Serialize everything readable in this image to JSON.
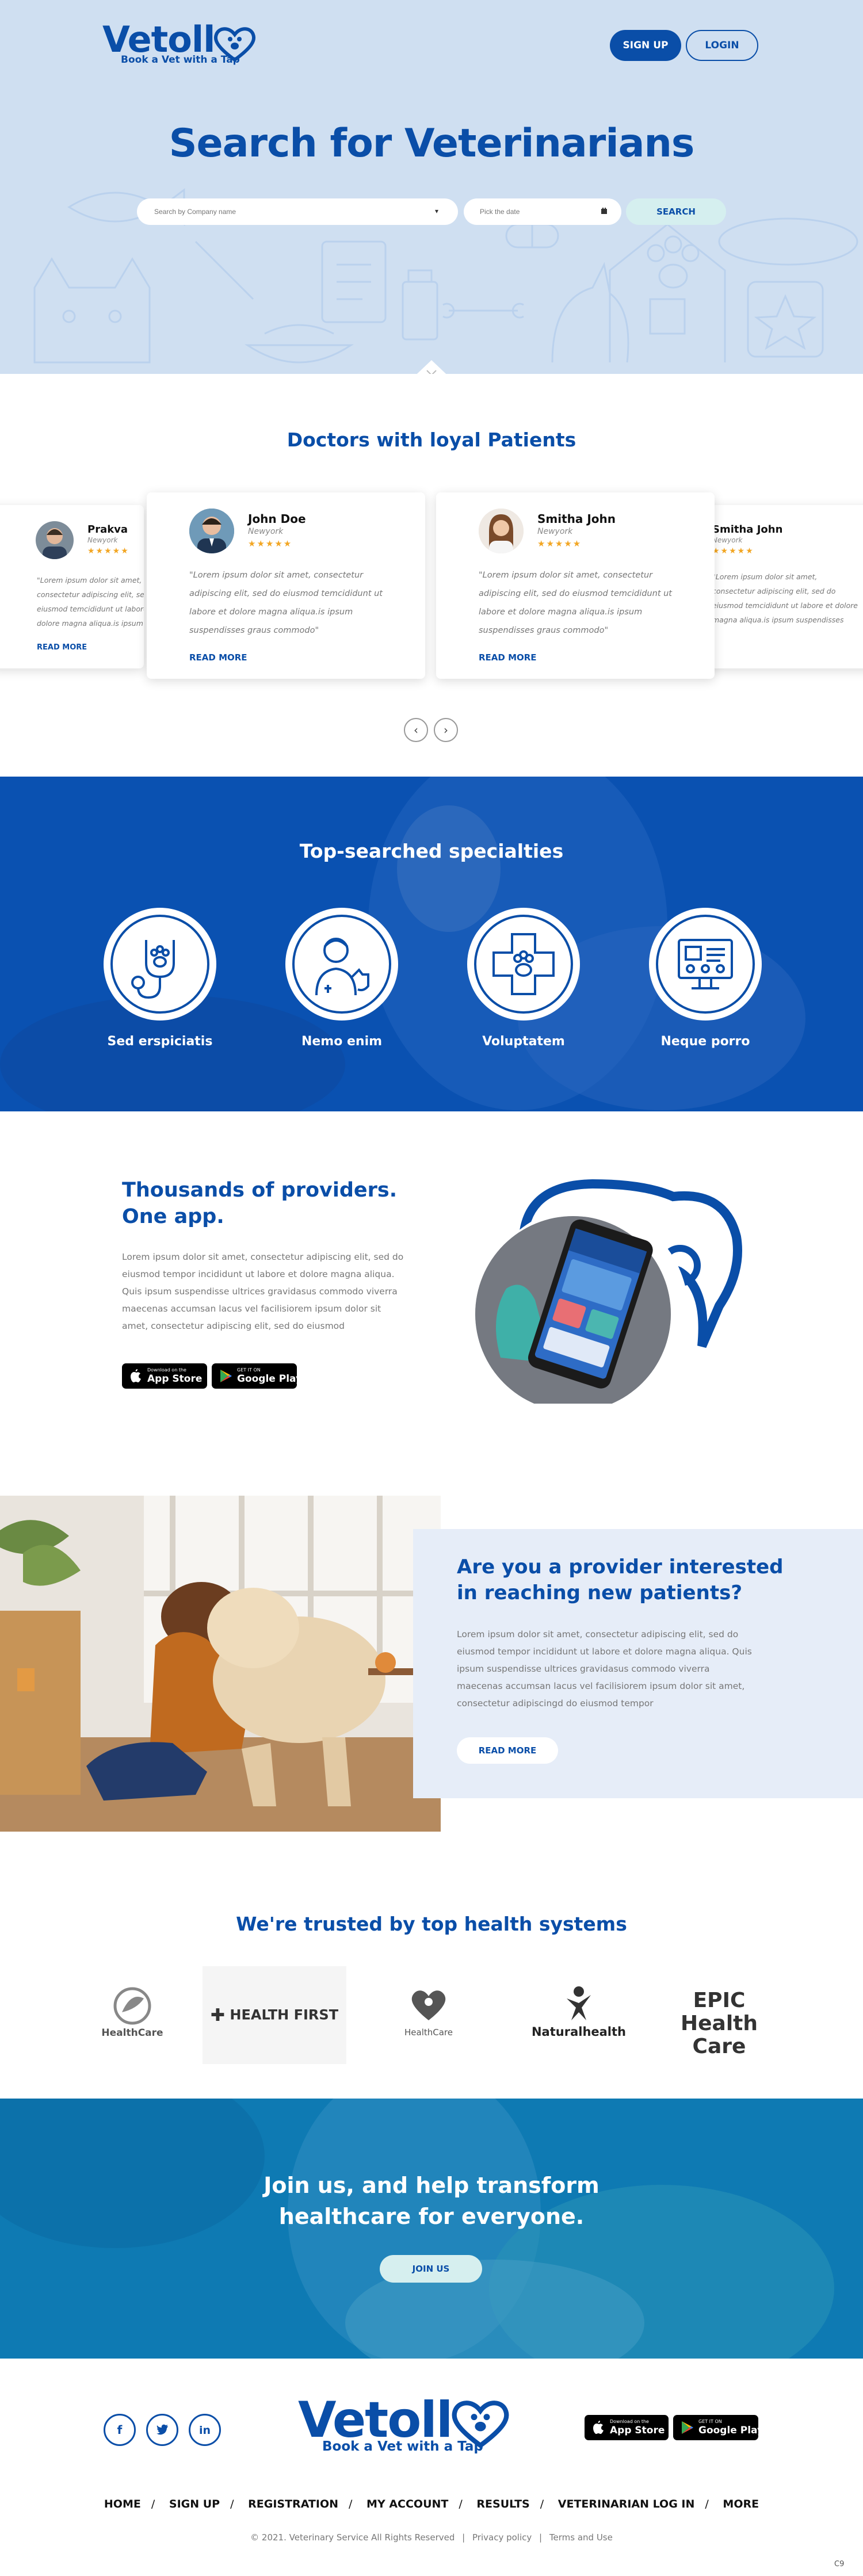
{
  "header": {
    "logo_text": "Vetoll",
    "logo_tagline": "Book a Vet with a Tap",
    "signup_label": "SIGN UP",
    "login_label": "LOGIN"
  },
  "hero": {
    "title": "Search for Veterinarians",
    "company_placeholder": "Search by Company name",
    "date_placeholder": "Pick the date",
    "search_label": "SEARCH"
  },
  "doctors": {
    "title": "Doctors with loyal Patients",
    "stars": "★★★★★",
    "read_more": "READ MORE",
    "cards": [
      {
        "name": "Prakva",
        "city": "Newyork",
        "quote": "\"Lorem ipsum dolor sit amet, consectetur adipiscing elit, sed do eiusmod temcididunt ut labore et dolore magna aliqua.is ipsum suspendisses graus commodo\""
      },
      {
        "name": "John Doe",
        "city": "Newyork",
        "quote": "\"Lorem ipsum dolor sit amet, consectetur adipiscing elit, sed do eiusmod temcididunt ut labore et dolore magna aliqua.is ipsum suspendisses graus commodo\""
      },
      {
        "name": "Smitha John",
        "city": "Newyork",
        "quote": "\"Lorem ipsum dolor sit amet, consectetur adipiscing elit, sed do eiusmod temcididunt ut labore et dolore magna aliqua.is ipsum suspendisses graus commodo\""
      },
      {
        "name": "Smitha John",
        "city": "Newyork",
        "quote": "\"Lorem ipsum dolor sit amet, consectetur adipiscing elit, sed do eiusmod temcididunt ut labore et dolore magna aliqua.is ipsum suspendisses graus commodo\""
      }
    ]
  },
  "specialties": {
    "title": "Top-searched specialties",
    "items": [
      {
        "label": "Sed erspiciatis",
        "icon": "stethoscope-paw-icon"
      },
      {
        "label": "Nemo enim",
        "icon": "vet-doctor-dog-icon"
      },
      {
        "label": "Voluptatem",
        "icon": "medical-cross-paw-icon"
      },
      {
        "label": "Neque porro",
        "icon": "pet-clinic-screen-icon"
      }
    ]
  },
  "providers": {
    "title_line1": "Thousands of providers.",
    "title_line2": "One app.",
    "text": "Lorem ipsum dolor sit amet, consectetur adipiscing elit, sed do eiusmod tempor incididunt ut labore et dolore magna aliqua. Quis ipsum suspendisse ultrices gravidasus commodo viverra maecenas accumsan lacus vel facilisiorem ipsum dolor sit amet, consectetur adipiscing elit, sed do eiusmod",
    "appstore_small": "Download on the",
    "appstore_big": "App Store",
    "googleplay_small": "GET IT ON",
    "googleplay_big": "Google Play"
  },
  "interest": {
    "title_line1": "Are you a provider interested",
    "title_line2": "in reaching new patients?",
    "text": "Lorem ipsum dolor sit amet, consectetur adipiscing elit, sed do eiusmod tempor incididunt ut labore et dolore magna aliqua. Quis ipsum suspendisse ultrices gravidasus commodo viverra maecenas accumsan lacus vel facilisiorem ipsum dolor sit amet, consectetur adipiscingd do eiusmod tempor",
    "read_more": "READ MORE"
  },
  "trusted": {
    "title": "We're trusted by top health systems",
    "logos": [
      "HealthCare",
      "HEALTH FIRST",
      "HealthCare",
      "Naturalhealth",
      "EPIC Health Care"
    ]
  },
  "join": {
    "title_line1": "Join us, and help transform",
    "title_line2": "healthcare for everyone.",
    "button": "JOIN US"
  },
  "footer": {
    "nav": [
      "HOME",
      "SIGN UP",
      "REGISTRATION",
      "MY ACCOUNT",
      "RESULTS",
      "VETERINARIAN LOG IN",
      "MORE"
    ],
    "copyright": "© 2021. Veterinary Service All Rights Reserved",
    "privacy": "Privacy policy",
    "terms": "Terms and Use",
    "corner": "C9"
  },
  "colors": {
    "brand_blue": "#0a4ea8",
    "hero_bg": "#cfdff1",
    "mint": "#d5efef",
    "star": "#f2a623"
  }
}
